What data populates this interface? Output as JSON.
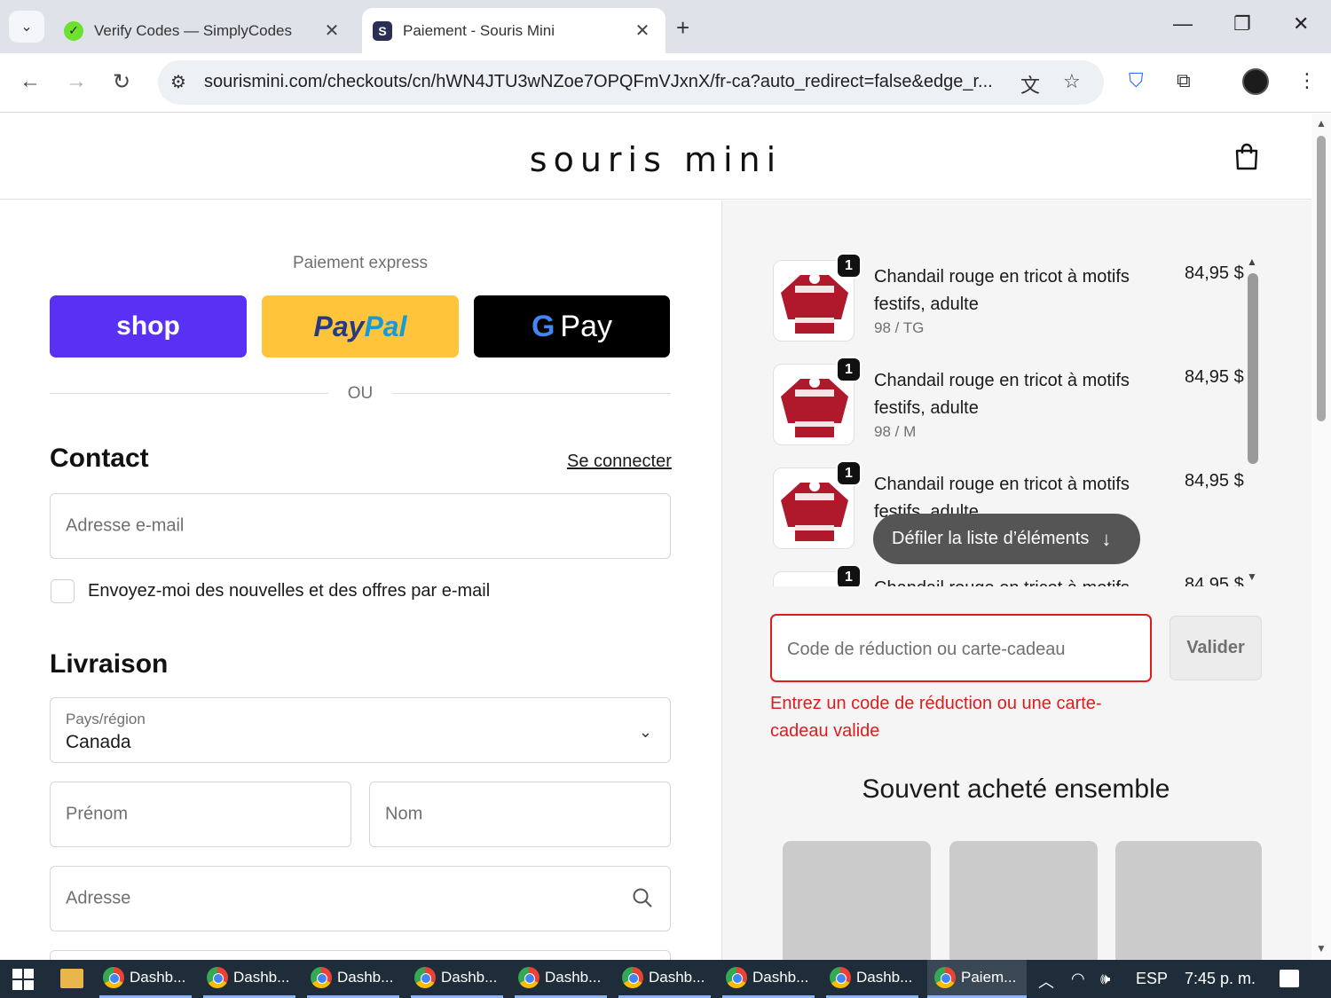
{
  "browser": {
    "tabs": [
      {
        "title": "Verify Codes — SimplyCodes",
        "favicon": "simplycodes-icon",
        "active": false
      },
      {
        "title": "Paiement - Souris Mini",
        "favicon": "S",
        "active": true
      }
    ],
    "url": "sourismini.com/checkouts/cn/hWN4JTU3wNZoe7OPQFmVJxnX/fr-ca?auto_redirect=false&edge_r..."
  },
  "header": {
    "logo": "souris mini"
  },
  "checkout": {
    "express_title": "Paiement express",
    "shop_label": "shop",
    "paypal_label_a": "Pay",
    "paypal_label_b": "Pal",
    "gpay_g": "G",
    "gpay_label": "Pay",
    "or_label": "OU",
    "contact_title": "Contact",
    "login_link": "Se connecter",
    "email_placeholder": "Adresse e-mail",
    "newsletter_label": "Envoyez-moi des nouvelles et des offres par e-mail",
    "shipping_title": "Livraison",
    "country_label": "Pays/région",
    "country_value": "Canada",
    "firstname_placeholder": "Prénom",
    "lastname_placeholder": "Nom",
    "address_placeholder": "Adresse"
  },
  "summary": {
    "items": [
      {
        "qty": "1",
        "name": "Chandail rouge en tricot à motifs festifs, adulte",
        "variant": "98 / TG",
        "price": "84,95 $"
      },
      {
        "qty": "1",
        "name": "Chandail rouge en tricot à motifs festifs, adulte",
        "variant": "98 / M",
        "price": "84,95 $"
      },
      {
        "qty": "1",
        "name": "Chandail rouge en tricot à motifs festifs, adulte",
        "variant": "",
        "price": "84,95 $"
      },
      {
        "qty": "1",
        "name": "Chandail rouge en tricot à motifs festifs, adulte",
        "variant": "",
        "price": "84,95 $"
      }
    ],
    "scroll_hint": "Défiler la liste d’éléments",
    "discount_placeholder": "Code de réduction ou carte-cadeau",
    "apply_label": "Valider",
    "discount_error": "Entrez un code de réduction ou une carte-cadeau valide",
    "often_bought_title": "Souvent acheté ensemble"
  },
  "taskbar": {
    "items": [
      "Dashb...",
      "Dashb...",
      "Dashb...",
      "Dashb...",
      "Dashb...",
      "Dashb...",
      "Dashb...",
      "Dashb...",
      "Paiem..."
    ],
    "language": "ESP",
    "time": "7:45 p. m."
  },
  "colors": {
    "shop": "#5a31f4",
    "paypal": "#ffc439",
    "gpay": "#000000",
    "error": "#dd1d1d"
  }
}
